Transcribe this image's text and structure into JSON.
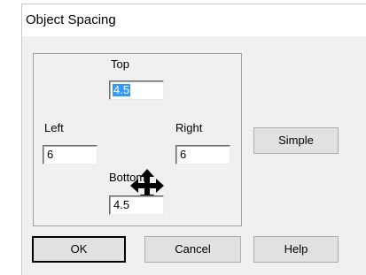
{
  "dialog": {
    "title": "Object Spacing"
  },
  "spacing": {
    "top": {
      "label": "Top",
      "value": "4.5"
    },
    "left": {
      "label": "Left",
      "value": "6"
    },
    "right": {
      "label": "Right",
      "value": "6"
    },
    "bottom": {
      "label": "Bottom",
      "value": "4.5"
    }
  },
  "buttons": {
    "simple": "Simple",
    "ok": "OK",
    "cancel": "Cancel",
    "help": "Help"
  },
  "icons": {
    "center": "move-arrows-icon"
  },
  "colors": {
    "selection": "#3399ff",
    "dialog_bg": "#f0f0f0",
    "button_bg": "#e1e1e1"
  }
}
